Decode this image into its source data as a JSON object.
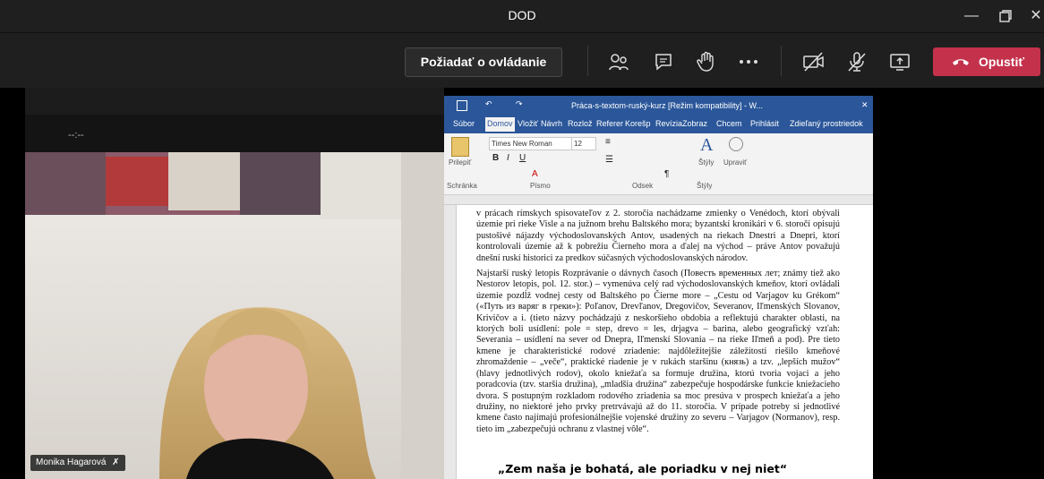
{
  "window": {
    "title": "DOD"
  },
  "toolbar": {
    "request_control_label": "Požiadať o ovládanie",
    "leave_label": "Opustiť"
  },
  "colors": {
    "leave": "#c4314b",
    "word_accent": "#2b579a",
    "teams_bg": "#1f1f1f"
  },
  "video": {
    "hint": "--:--",
    "participant_name": "Monika Hagarová"
  },
  "word": {
    "title": "Práca-s-textom-ruský-kurz [Režim kompatibility] - W...",
    "tabs": [
      "Súbor",
      "Domov",
      "Vložiť",
      "Návrh",
      "Rozlož",
      "Referer",
      "Korešp",
      "Revízia",
      "Zobraz",
      "Chcem",
      "Prihlásit",
      "Zdieľaný prostriedok"
    ],
    "font_name": "Times New Roman",
    "font_size": "12",
    "group_labels": {
      "clipboard": "Schránka",
      "font": "Písmo",
      "paragraph": "Odsek",
      "styles": "Štýly"
    },
    "buttons": {
      "paste": "Prilepiť",
      "styles": "Štýly",
      "edit": "Upraviť"
    },
    "paragraph1": "v prácach rímskych spisovateľov z 2. storočia nachádzame zmienky o Venédoch, ktorí obývali územie pri rieke Visle a na južnom brehu Baltského mora; byzantskí kronikári v 6. storočí opisujú pustošivé nájazdy východoslovanských Antov, usadených na riekach Dnestri a Dnepri, ktorí kontrolovali územie až k pobrežiu Čierneho mora a ďalej na východ – práve Antov považujú dnešní ruskí historici za predkov súčasných východoslovanských národov.",
    "paragraph2": "Najstarší ruský letopis Rozprávanie o dávnych časoch (Повесть временных лет; známy tiež ako Nestorov letopis, pol. 12. stor.) – vymenúva celý rad východoslovanských kmeňov, ktorí ovládali územie pozdĺž vodnej cesty od Baltského po Čierne more – „Cestu od Varjagov ku Grékom“ («Путь из варяг в греки»): Poľanov, Drevľanov, Dregovičov, Severanov, Iľmenských Slovanov, Krivičov a i. (tieto názvy pochádzajú z neskoršieho obdobia a reflektujú charakter oblasti, na ktorých boli usídlení: pole = step, drevo = les, drjagva – barina, alebo geografický vzťah: Severania – usídlení na sever od Dnepra, Iľmenskí Slovania – na rieke Iľmeň a pod). Pre tieto kmene je charakteristické rodové zriadenie: najdôležitejšie záležitosti riešilo kmeňové zhromaždenie – „veče“, praktické riadenie je v rukách staršinu (князь) a tzv. „lepších mužov“ (hlavy jednotlivých rodov), okolo kniežaťa sa formuje družina, ktorú tvoria vojaci a jeho poradcovia (tzv. staršia družina), „mladšia družina“ zabezpečuje hospodárske funkcie kniežacieho dvora. S postupným rozkladom rodového zriadenia sa moc presúva v prospech kniežaťa a jeho družiny, no niektoré jeho prvky pretrvávajú až do 11. storočia. V prípade potreby si jednotlivé kmene často najímajú profesionálnejšie vojenské družiny zo severu – Varjagov (Normanov), resp. tieto im „zabezpečujú ochranu z vlastnej vôle“.",
    "heading": "„Zem naša je bohatá, ale poriadku v nej niet“"
  }
}
